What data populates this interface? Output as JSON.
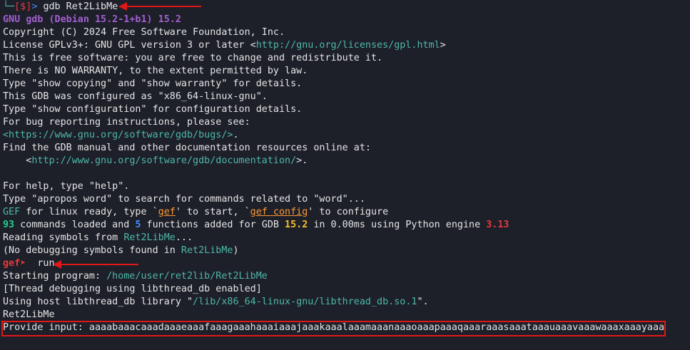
{
  "prompt1": {
    "corner": "└─",
    "bracket": "[$]",
    "symbol": ">",
    "command": "gdb Ret2LibMe"
  },
  "banner": {
    "version_line": "GNU gdb (Debian 15.2-1+b1) 15.2",
    "copyright": "Copyright (C) 2024 Free Software Foundation, Inc.",
    "license_prefix": "License GPLv3+: GNU GPL version 3 or later <",
    "license_url": "http://gnu.org/licenses/gpl.html",
    "license_suffix": ">",
    "free_software": "This is free software: you are free to change and redistribute it.",
    "no_warranty": "There is NO WARRANTY, to the extent permitted by law.",
    "show_copying": "Type \"show copying\" and \"show warranty\" for details.",
    "configured": "This GDB was configured as \"x86_64-linux-gnu\".",
    "show_config": "Type \"show configuration\" for configuration details.",
    "bug_reporting": "For bug reporting instructions, please see:",
    "bugs_url": "<https://www.gnu.org/software/gdb/bugs/>",
    "bugs_suffix": ".",
    "manual": "Find the GDB manual and other documentation resources online at:",
    "doc_indent": "    <",
    "doc_url": "http://www.gnu.org/software/gdb/documentation/",
    "doc_suffix": ">.",
    "help": "For help, type \"help\".",
    "apropos": "Type \"apropos word\" to search for commands related to \"word\"..."
  },
  "gef": {
    "ready_word": "GEF",
    "ready_mid": " for linux ready, type `",
    "gef_cmd": "gef",
    "ready_mid2": "' to start, `",
    "gef_config": "gef config",
    "ready_end": "' to configure",
    "count_commands": "93",
    "loaded_mid": " commands loaded and ",
    "count_functions": "5",
    "loaded_mid2": " functions added for GDB ",
    "gdb_version": "15.2",
    "loaded_mid3": " in 0.00ms using Python engine ",
    "python_version": "3.13"
  },
  "symbols": {
    "reading_prefix": "Reading symbols from ",
    "binary": "Ret2LibMe",
    "reading_suffix": "...",
    "nodebug_prefix": "(No debugging symbols found in ",
    "nodebug_binary": "Ret2LibMe",
    "nodebug_suffix": ")"
  },
  "prompt2": {
    "label": "gef➤",
    "command": "  run"
  },
  "run": {
    "starting_prefix": "Starting program: ",
    "program_path": "/home/user/ret2lib/Ret2LibMe",
    "thread_debug": "[Thread debugging using libthread_db enabled]",
    "host_lib_prefix": "Using host libthread_db library \"",
    "host_lib_path": "/lib/x86_64-linux-gnu/libthread_db.so.1",
    "host_lib_suffix": "\".",
    "program_name": "Ret2LibMe",
    "input_line": "Provide input: aaaabaaacaaadaaaeaaafaaagaaahaaaiaaajaaakaaalaaamaaanaaaoaaapaaaqaaaraaasaaataaauaaavaaawaaaxaaayaaa"
  },
  "colors": {
    "background": "#1d1f29",
    "annotation_red": "#e01818"
  }
}
